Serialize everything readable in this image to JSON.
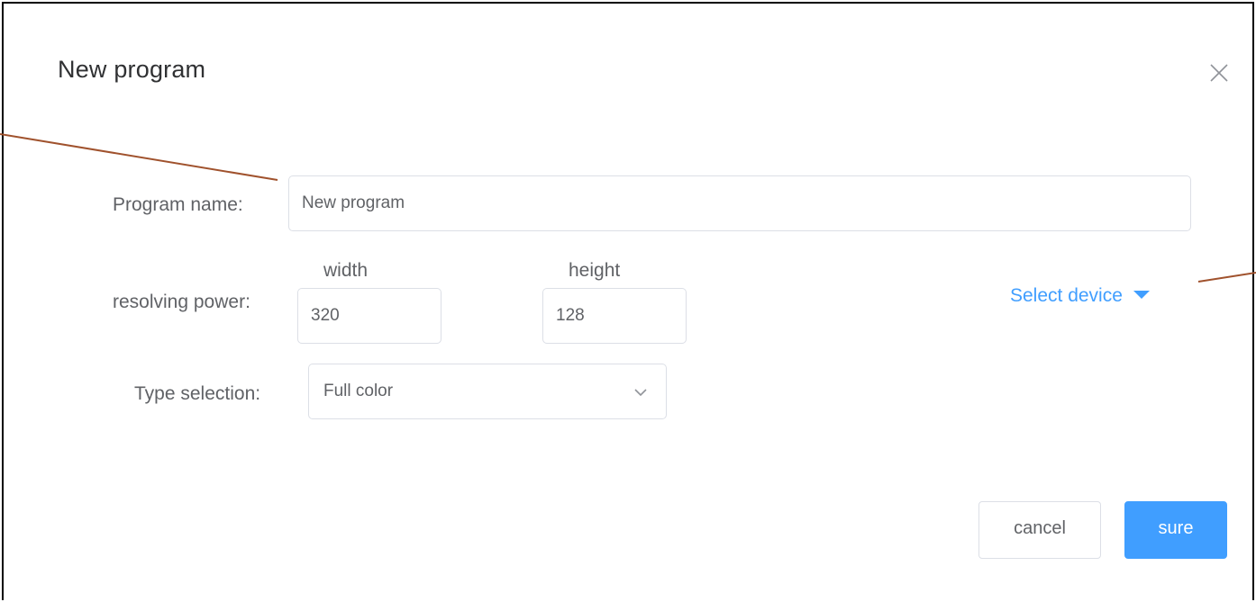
{
  "dialog": {
    "title": "New program",
    "close_icon": "close-icon"
  },
  "form": {
    "program_name": {
      "label": "Program name:",
      "value": "New program"
    },
    "resolution": {
      "label": "resolving power:",
      "width_label": "width",
      "height_label": "height",
      "width_value": "320",
      "height_value": "128"
    },
    "type_selection": {
      "label": "Type selection:",
      "selected": "Full color",
      "arrow_icon": "chevron-down-icon"
    },
    "device": {
      "label": "Select device",
      "caret_icon": "caret-down-icon"
    }
  },
  "footer": {
    "cancel_label": "cancel",
    "sure_label": "sure"
  },
  "colors": {
    "accent": "#409eff",
    "annotation": "#a0522d",
    "border": "#dcdfe6",
    "text": "#606266"
  }
}
